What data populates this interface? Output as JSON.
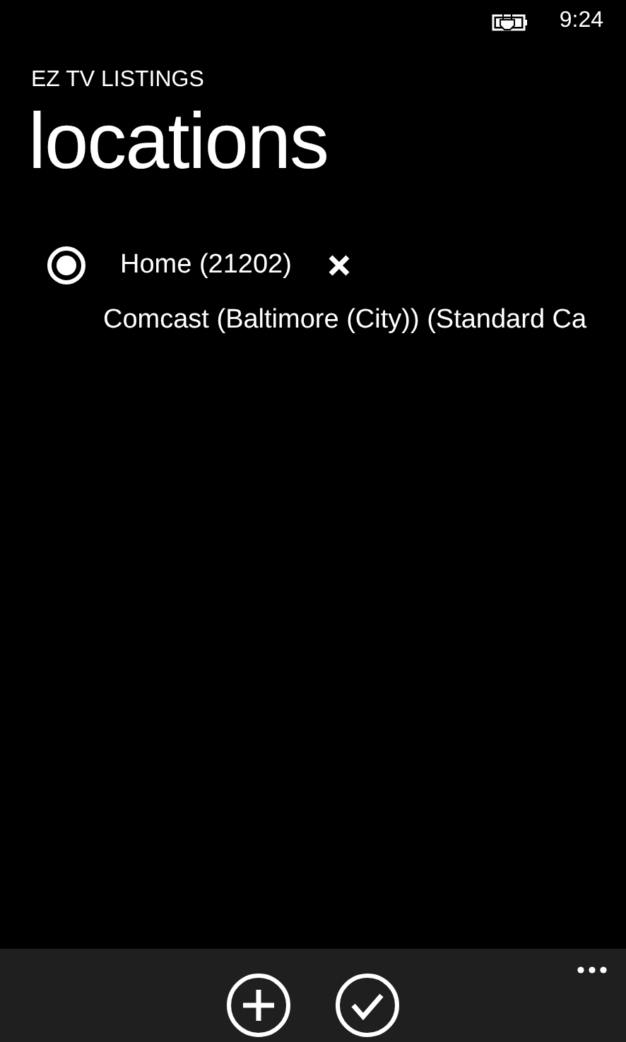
{
  "status_bar": {
    "time": "9:24"
  },
  "app_title": "EZ TV LISTINGS",
  "page_title": "locations",
  "locations": [
    {
      "name": "Home (21202)",
      "selected": true,
      "provider": "Comcast (Baltimore (City)) (Standard Ca"
    }
  ],
  "app_bar": {
    "buttons": [
      {
        "kind": "add"
      },
      {
        "kind": "check"
      }
    ]
  }
}
